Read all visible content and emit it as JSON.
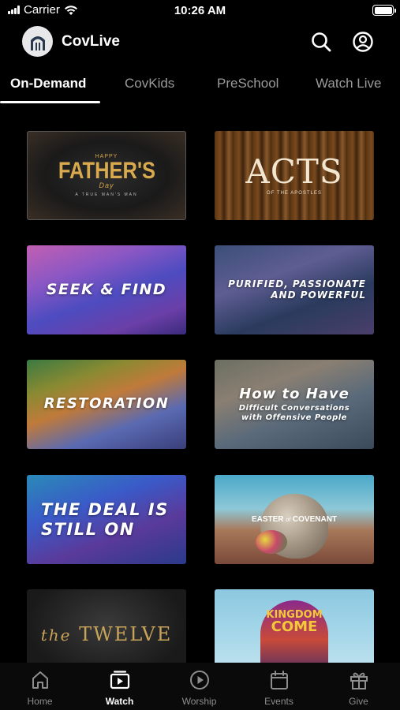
{
  "status_bar": {
    "carrier": "Carrier",
    "time": "10:26 AM"
  },
  "header": {
    "title": "CovLive",
    "logo_icon": "church-logo",
    "search_icon": "search-icon",
    "profile_icon": "profile-icon"
  },
  "tabs": [
    {
      "label": "On-Demand",
      "active": true
    },
    {
      "label": "CovKids",
      "active": false
    },
    {
      "label": "PreSchool",
      "active": false
    },
    {
      "label": "Watch Live",
      "active": false
    }
  ],
  "cards": [
    {
      "small": "HAPPY",
      "title": "FATHER'S",
      "script": "Day",
      "tag": "A TRUE MAN'S MAN"
    },
    {
      "title": "ACTS",
      "subtitle": "OF THE APOSTLES"
    },
    {
      "title": "SEEK & FIND"
    },
    {
      "title": "PURIFIED, PASSIONATE AND POWERFUL"
    },
    {
      "title": "RESTORATION"
    },
    {
      "title": "How to Have",
      "subtitle": "Difficult Conversations with Offensive People"
    },
    {
      "title": "THE DEAL IS STILL ON"
    },
    {
      "title": "EASTER",
      "connector": "of",
      "title2": "COVENANT"
    },
    {
      "prefix": "the",
      "title": "TWELVE"
    },
    {
      "title": "KINGDOM",
      "title2": "COME"
    }
  ],
  "bottom_nav": [
    {
      "label": "Home",
      "icon": "home-icon",
      "active": false
    },
    {
      "label": "Watch",
      "icon": "watch-icon",
      "active": true
    },
    {
      "label": "Worship",
      "icon": "play-circle-icon",
      "active": false
    },
    {
      "label": "Events",
      "icon": "calendar-icon",
      "active": false
    },
    {
      "label": "Give",
      "icon": "gift-icon",
      "active": false
    }
  ],
  "colors": {
    "background": "#000000",
    "inactive_text": "#9a9a9a",
    "active_text": "#ffffff"
  }
}
